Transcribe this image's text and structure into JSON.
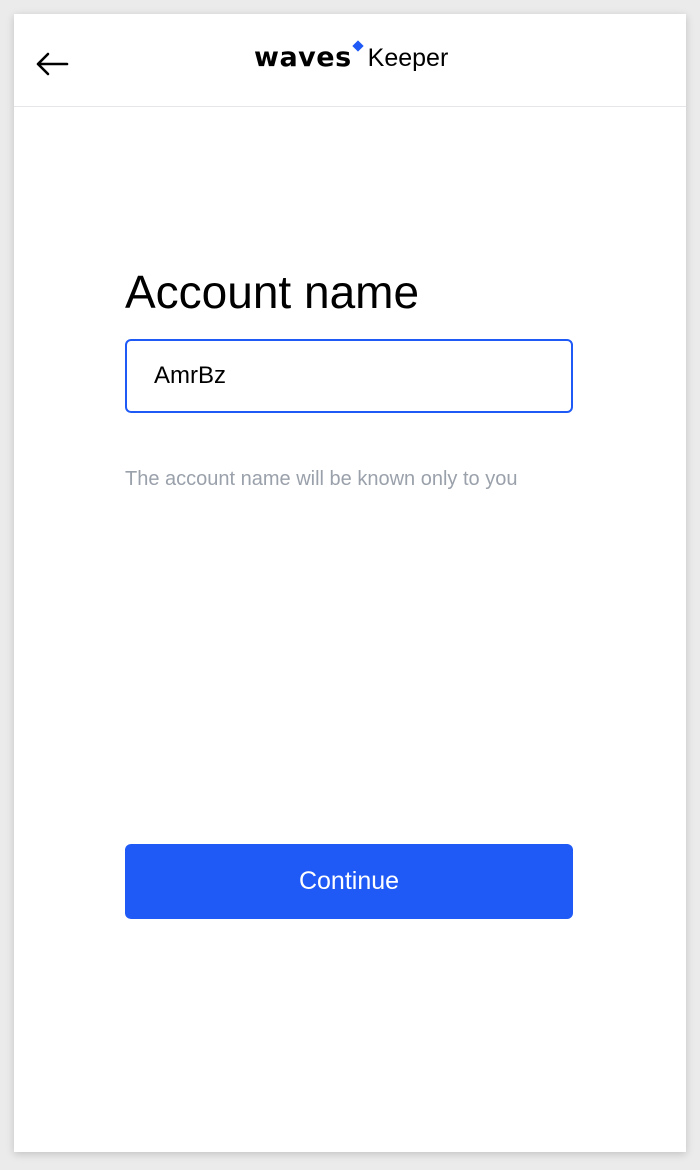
{
  "header": {
    "back_icon": "arrow-left-icon",
    "logo": {
      "brand": "waves",
      "product": "Keeper",
      "accent_color": "#1f5af6"
    }
  },
  "form": {
    "title": "Account name",
    "input": {
      "value": "AmrBz",
      "border_color": "#1f5af6"
    },
    "hint": "The account name will be known only to you",
    "continue_label": "Continue",
    "button_color": "#1f5af6"
  }
}
